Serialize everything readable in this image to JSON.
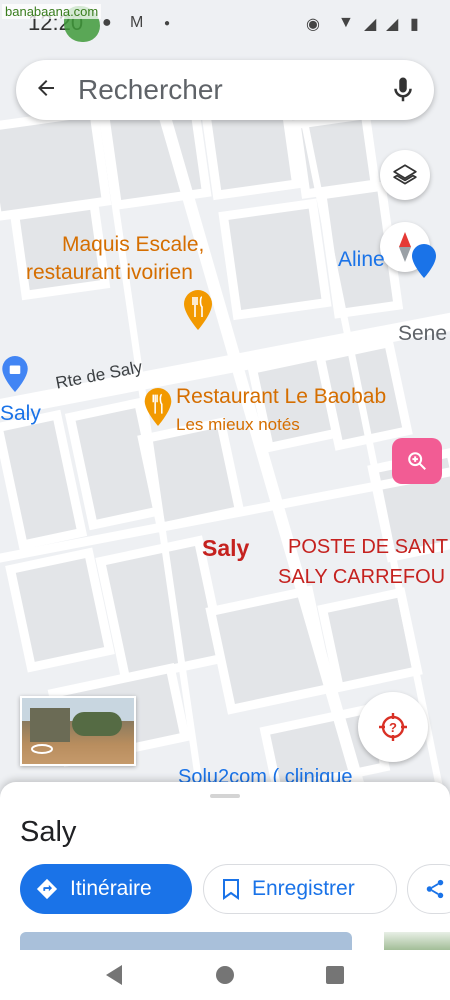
{
  "status_bar": {
    "time": "12:20",
    "watermark": "banabaana.com",
    "icons": [
      "chat-icon",
      "gmail-icon",
      "dot-icon",
      "location-icon",
      "wifi-icon",
      "signal-icon",
      "signal-icon",
      "battery-icon"
    ]
  },
  "search": {
    "placeholder": "Rechercher",
    "back_icon": "arrow-back-icon",
    "mic_icon": "microphone-icon"
  },
  "map": {
    "labels": {
      "maquis": "Maquis Escale,",
      "maquis2": "restaurant ivoirien",
      "road": "Rte de Saly",
      "baobab": "Restaurant Le Baobab",
      "baobab_sub": "Les mieux notés",
      "aline": "Aline",
      "sene": "Sene",
      "saly_left": "Saly",
      "saly_center": "Saly",
      "poste": "POSTE DE SANT",
      "carrefour": "SALY CARREFOU",
      "solu2com": "Solu2com ( clinique"
    },
    "colors": {
      "poi_orange": "#d56e00",
      "pin_orange": "#f29900",
      "label_red": "#c5221f",
      "pink_button": "#f25c94",
      "blue": "#1a73e8"
    }
  },
  "sheet": {
    "place_name": "Saly",
    "directions_label": "Itinéraire",
    "save_label": "Enregistrer"
  }
}
